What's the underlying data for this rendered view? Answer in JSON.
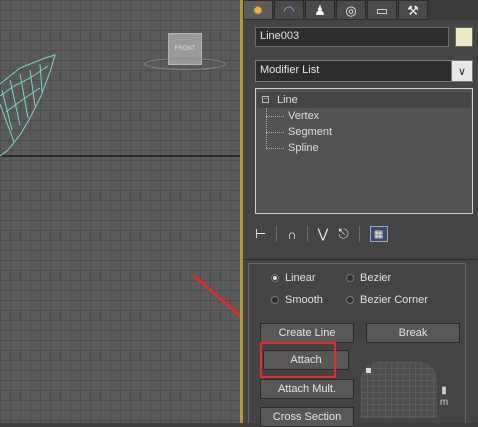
{
  "viewport": {
    "cube_label": "FRONT"
  },
  "tabs": [
    {
      "icon": "create-icon",
      "glyph": "✹",
      "active": true
    },
    {
      "icon": "modify-icon",
      "glyph": "◠",
      "active": false
    },
    {
      "icon": "hierarchy-icon",
      "glyph": "♟",
      "active": false
    },
    {
      "icon": "motion-icon",
      "glyph": "◎",
      "active": false
    },
    {
      "icon": "display-icon",
      "glyph": "▭",
      "active": false
    },
    {
      "icon": "utilities-icon",
      "glyph": "⚒",
      "active": false
    }
  ],
  "object": {
    "name": "Line003",
    "color": "#ede7c4"
  },
  "modifier_list": {
    "label": "Modifier List"
  },
  "stack": {
    "root": "Line",
    "root_toggle": "−",
    "subobjects": [
      "Vertex",
      "Segment",
      "Spline"
    ]
  },
  "stack_tools": [
    "pin-stack-icon",
    "show-end-result-icon",
    "make-unique-icon",
    "remove-modifier-icon",
    "configure-sets-icon"
  ],
  "creation": {
    "options": [
      {
        "label": "Linear",
        "selected": true
      },
      {
        "label": "Bezier",
        "selected": false
      },
      {
        "label": "Smooth",
        "selected": false
      },
      {
        "label": "Bezier Corner",
        "selected": false
      }
    ]
  },
  "buttons": {
    "create_line": "Create Line",
    "break": "Break",
    "attach": "Attach",
    "attach_mult": "Attach Mult.",
    "cross_section": "Cross Section"
  },
  "side_glyph": "m",
  "annotation_color": "#e82828"
}
